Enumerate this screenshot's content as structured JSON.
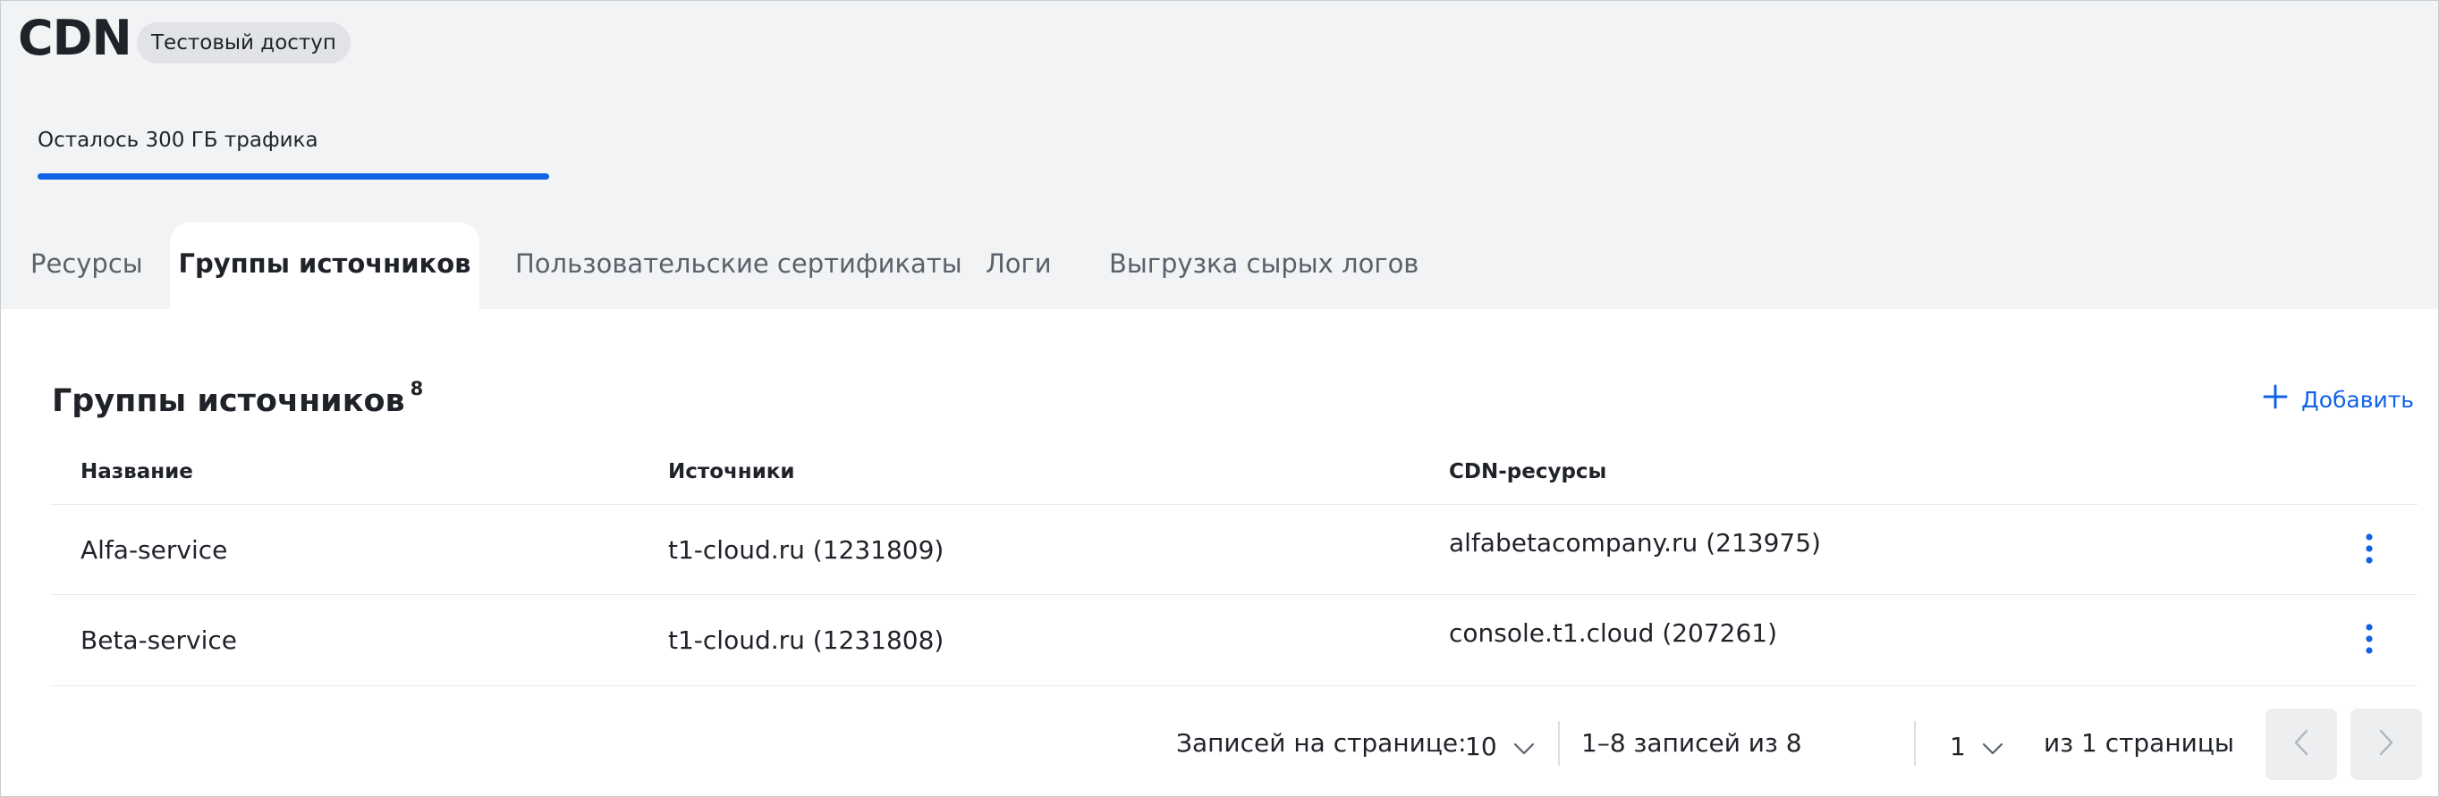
{
  "header": {
    "title": "CDN",
    "badge": "Тестовый доступ",
    "quota_label": "Осталось 300 ГБ трафика",
    "quota_fraction": 1.0
  },
  "tabs": [
    {
      "label": "Ресурсы",
      "active": false
    },
    {
      "label": "Группы источников",
      "active": true
    },
    {
      "label": "Пользовательские сертификаты",
      "active": false
    },
    {
      "label": "Логи",
      "active": false
    },
    {
      "label": "Выгрузка сырых логов",
      "active": false
    }
  ],
  "section": {
    "title": "Группы источников",
    "count": "8",
    "add_label": "Добавить"
  },
  "table": {
    "columns": [
      "Название",
      "Источники",
      "CDN-ресурсы"
    ],
    "rows": [
      {
        "name": "Alfa-service",
        "source": "t1-cloud.ru (1231809)",
        "cdn": "alfabetacompany.ru (213975)"
      },
      {
        "name": "Beta-service",
        "source": "t1-cloud.ru (1231808)",
        "cdn": "console.t1.cloud (207261)"
      }
    ]
  },
  "pagination": {
    "per_page_label": "Записей на странице:",
    "per_page_value": "10",
    "range_text": "1–8 записей из 8",
    "page_value": "1",
    "pages_text": "из 1 страницы"
  },
  "colors": {
    "accent": "#1262e6",
    "header_bg": "#f2f3f5"
  },
  "icons": {
    "add": "plus-icon",
    "row_menu": "more-vertical-icon",
    "dropdown": "chevron-down-icon",
    "prev": "chevron-left-icon",
    "next": "chevron-right-icon"
  }
}
